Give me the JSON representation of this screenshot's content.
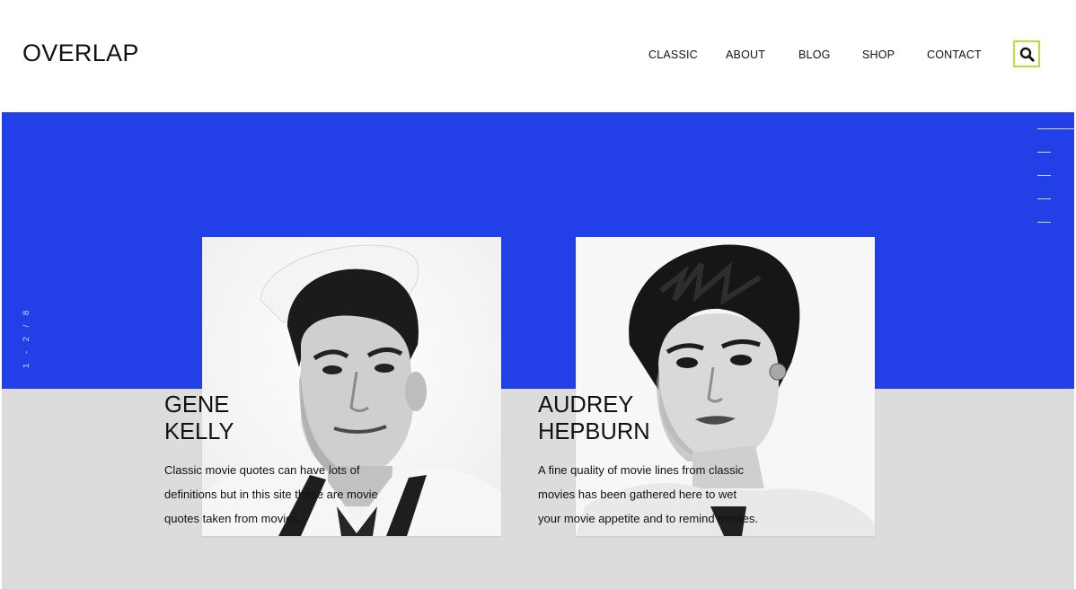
{
  "brand": {
    "logo": "OVERLAP",
    "accent": "#233fe8",
    "search_border": "#b7e03a"
  },
  "nav": {
    "items": [
      {
        "label": "CLASSIC"
      },
      {
        "label": "ABOUT"
      },
      {
        "label": "BLOG"
      },
      {
        "label": "SHOP"
      },
      {
        "label": "CONTACT"
      }
    ],
    "search_icon": "search-icon"
  },
  "slider": {
    "counter": "1 - 2 / 8",
    "dot_count": 5,
    "active_dot": 1
  },
  "cards": [
    {
      "title_line1": "GENE",
      "title_line2": "KELLY",
      "text": "Classic movie quotes can have lots of definitions but in this site these are movie quotes taken from movies.",
      "image": "black-and-white portrait of a man in a white sailor cap and sailor uniform"
    },
    {
      "title_line1": "AUDREY",
      "title_line2": "HEPBURN",
      "text": "A fine quality of movie lines from classic movies has been gathered here to wet your movie appetite and to remind movies.",
      "image": "black-and-white portrait of a woman with short dark hair and earrings"
    }
  ]
}
